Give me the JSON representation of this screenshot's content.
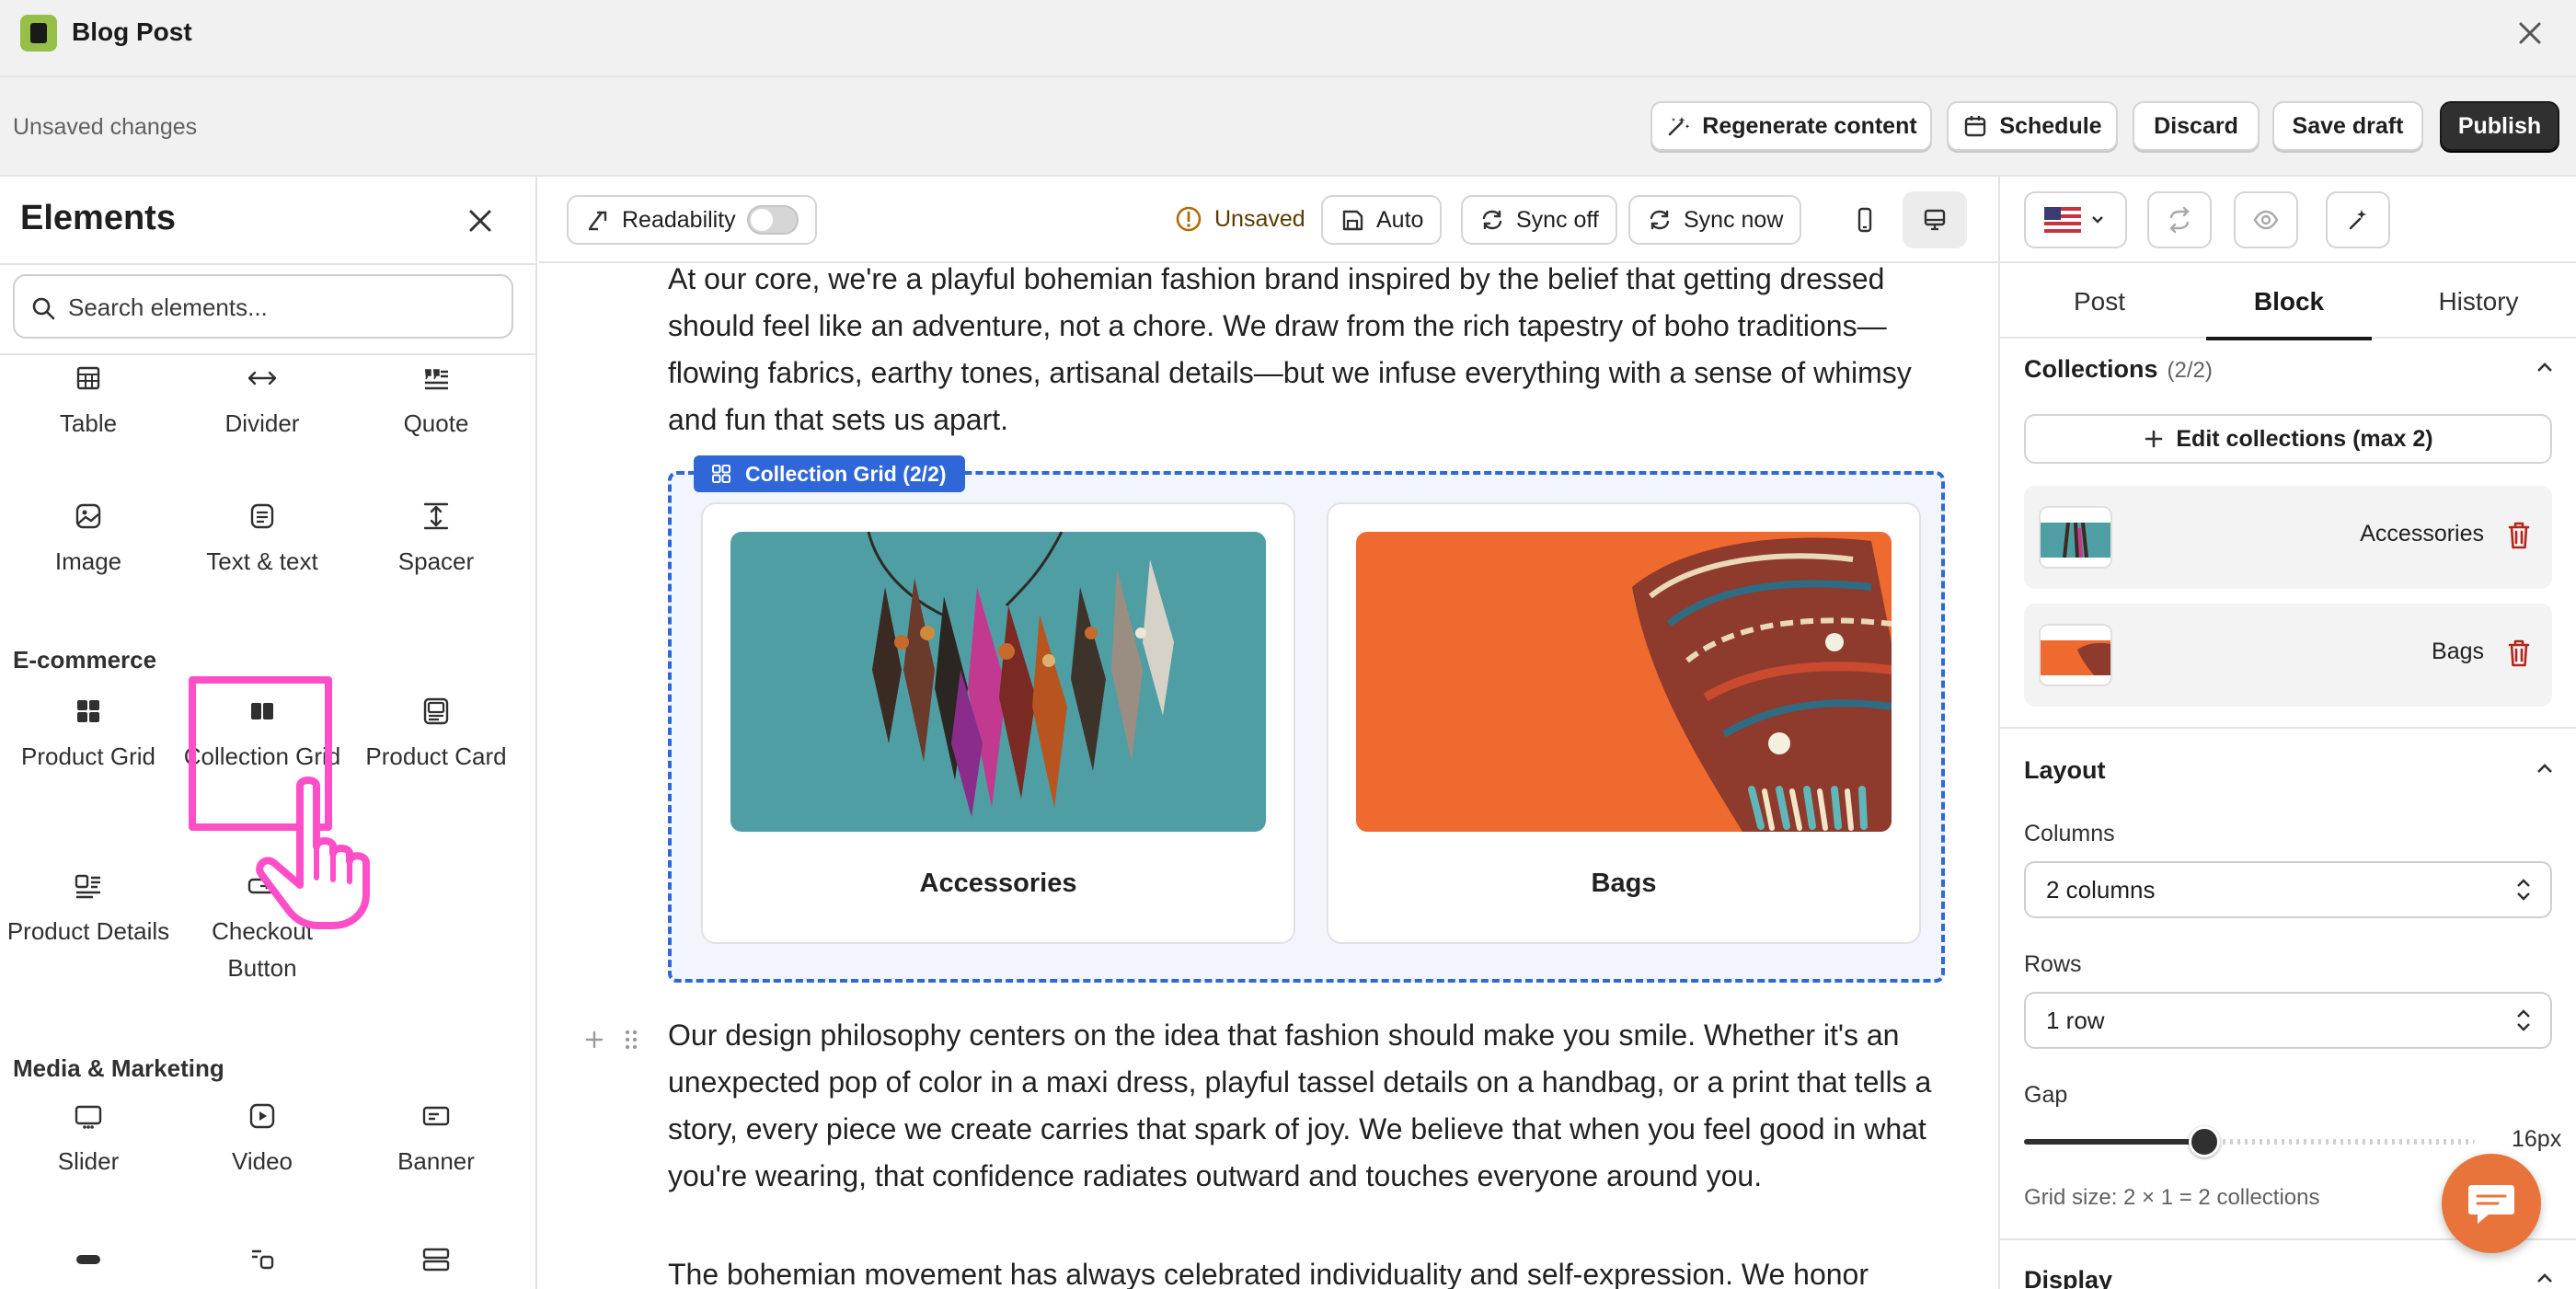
{
  "window": {
    "title": "Blog Post"
  },
  "actionbar": {
    "status": "Unsaved changes",
    "regenerate": "Regenerate content",
    "schedule": "Schedule",
    "discard": "Discard",
    "save_draft": "Save draft",
    "publish": "Publish"
  },
  "elements_panel": {
    "title": "Elements",
    "search_placeholder": "Search elements...",
    "basic_items": [
      {
        "label": "Table",
        "icon": "table-icon"
      },
      {
        "label": "Divider",
        "icon": "divider-icon"
      },
      {
        "label": "Quote",
        "icon": "quote-icon"
      },
      {
        "label": "Image",
        "icon": "image-icon"
      },
      {
        "label": "Text & text",
        "icon": "text-text-icon"
      },
      {
        "label": "Spacer",
        "icon": "spacer-icon"
      }
    ],
    "ecommerce_title": "E-commerce",
    "ecommerce_items": [
      {
        "label": "Product Grid",
        "icon": "product-grid-icon"
      },
      {
        "label": "Collection Grid",
        "icon": "collection-grid-icon"
      },
      {
        "label": "Product Card",
        "icon": "product-card-icon"
      },
      {
        "label": "Product Details",
        "icon": "product-details-icon"
      },
      {
        "label": "Checkout Button",
        "icon": "checkout-button-icon"
      }
    ],
    "media_title": "Media & Marketing",
    "media_items": [
      {
        "label": "Slider",
        "icon": "slider-icon"
      },
      {
        "label": "Video",
        "icon": "video-icon"
      },
      {
        "label": "Banner",
        "icon": "banner-icon"
      }
    ]
  },
  "editor_toolbar": {
    "readability": "Readability",
    "readability_on": false,
    "status": "Unsaved",
    "auto": "Auto",
    "sync_off": "Sync off",
    "sync_now": "Sync now",
    "active_device": "desktop"
  },
  "content": {
    "paragraph_1": "At our core, we're a playful bohemian fashion brand inspired by the belief that getting dressed should feel like an adventure, not a chore. We draw from the rich tapestry of boho traditions—flowing fabrics, earthy tones, artisanal details—but we infuse everything with a sense of whimsy and fun that sets us apart.",
    "grid_label": "Collection Grid (2/2)",
    "collections": [
      {
        "name": "Accessories",
        "color": "#4f9ea3"
      },
      {
        "name": "Bags",
        "color": "#ee6a2e"
      }
    ],
    "paragraph_2": "Our design philosophy centers on the idea that fashion should make you smile. Whether it's an unexpected pop of color in a maxi dress, playful tassel details on a handbag, or a print that tells a story, every piece we create carries that spark of joy. We believe that when you feel good in what you're wearing, that confidence radiates outward and touches everyone around you.",
    "paragraph_3": "The bohemian movement has always celebrated individuality and self-expression. We honor"
  },
  "settings_panel": {
    "tabs": [
      "Post",
      "Block",
      "History"
    ],
    "active_tab": "Block",
    "collections_title": "Collections",
    "collections_count": "(2/2)",
    "edit_collections": "Edit collections (max 2)",
    "items": [
      "Accessories",
      "Bags"
    ],
    "layout_title": "Layout",
    "columns_label": "Columns",
    "columns_value": "2 columns",
    "rows_label": "Rows",
    "rows_value": "1 row",
    "gap_label": "Gap",
    "gap_value": "16px",
    "gap_fraction": 0.4,
    "grid_size": "Grid size: 2 × 1 = 2 collections",
    "display_title": "Display"
  },
  "colors": {
    "accent_blue": "#2f67d8",
    "highlight_pink": "#ff4fc8",
    "chat_orange": "#e8743b",
    "danger_red": "#b3261e"
  }
}
